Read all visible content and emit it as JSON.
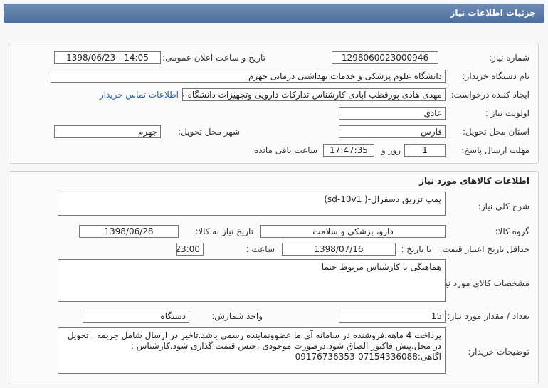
{
  "header": {
    "title": "جزئیات اطلاعات نیاز"
  },
  "info": {
    "need_number_label": "شماره نیاز:",
    "need_number": "1298060023000946",
    "announce_label": "تاریخ و ساعت اعلان عمومی:",
    "announce_value": "1398/06/23 - 14:05",
    "buyer_label": "نام دستگاه خریدار:",
    "buyer_value": "دانشگاه علوم پزشکی و خدمات بهداشتی درمانی جهرم",
    "creator_label": "ایجاد کننده درخواست:",
    "creator_value": "مهدی هادی پورقطب آبادی کارشناس تدارکات دارویی وتجهیزات دانشگاه علوم پز",
    "contact_link": "اطلاعات تماس خریدار",
    "priority_label": "اولویت نیاز :",
    "priority_value": "عادي",
    "province_label": "استان محل تحویل:",
    "province_value": "فارس",
    "city_label": "شهر محل تحویل:",
    "city_value": "جهرم",
    "deadline_label": "مهلت ارسال پاسخ:",
    "days_value": "1",
    "days_unit": "روز و",
    "time_value": "17:47:35",
    "remaining_label": "ساعت باقی مانده"
  },
  "goods": {
    "section_title": "اطلاعات کالاهای مورد نیاز",
    "summary_label": "شرح کلی نیاز:",
    "summary_value": "پمپ تزریق دسفرال-( sd-10v1)",
    "group_label": "گروه کالا:",
    "group_value": "دارو، پزشکی و سلامت",
    "need_date_label": "تاریخ نیاز به کالا:",
    "need_date_value": "1398/06/28",
    "validity_label": "حداقل تاریخ اعتبار قیمت:",
    "until_date_label": "تا تاریخ :",
    "until_date_value": "1398/07/16",
    "time_label": "ساعت :",
    "time_value": "23:00",
    "specs_label": "مشخصات کالای مورد نیاز:",
    "specs_value": "هماهنگی با کارشناس مربوط حتما",
    "qty_label": "تعداد / مقدار مورد نیاز:",
    "qty_value": "15",
    "unit_label": "واحد شمارش:",
    "unit_value": "دستگاه",
    "notes_label": "توضیحات خریدار:",
    "notes_value": "پرداخت 4 ماهه.فروشنده در سامانه آی ما عضوونماینده رسمی باشد.تاخیر در ارسال شامل جریمه . تحویل در محل.پیش فاکتور الصاق شود.درصورت موجودی ،جنس قیمت گذاری شود.کارشناس : آگاهی:07154336088-09176736353"
  }
}
